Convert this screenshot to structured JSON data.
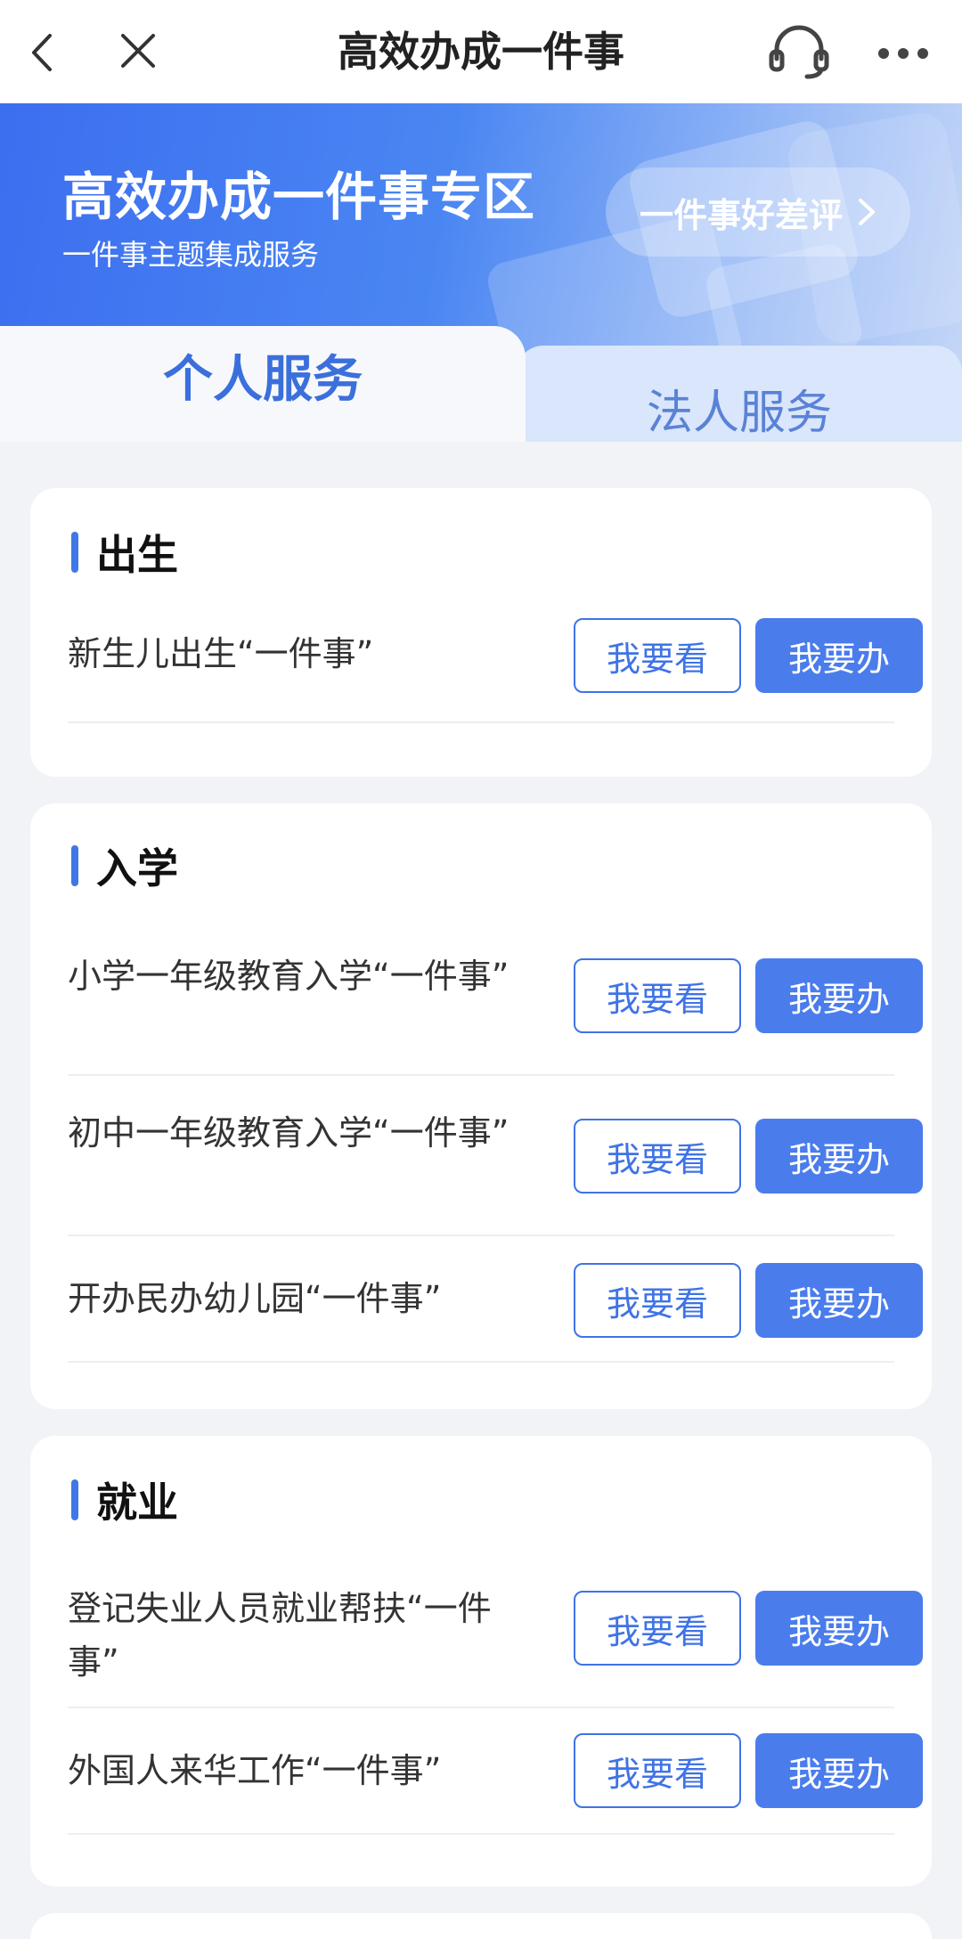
{
  "nav": {
    "title": "高效办成一件事"
  },
  "banner": {
    "title": "高效办成一件事专区",
    "subtitle": "一件事主题集成服务",
    "review_label": "一件事好差评"
  },
  "tabs": [
    {
      "label": "个人服务",
      "active": true
    },
    {
      "label": "法人服务",
      "active": false
    }
  ],
  "buttons": {
    "view": "我要看",
    "do": "我要办"
  },
  "sections": [
    {
      "title": "出生",
      "items": [
        {
          "name": "新生儿出生“一件事”"
        }
      ]
    },
    {
      "title": "入学",
      "items": [
        {
          "name": "小学一年级教育入学“一件事”"
        },
        {
          "name": "初中一年级教育入学“一件事”"
        },
        {
          "name": "开办民办幼儿园“一件事”"
        }
      ]
    },
    {
      "title": "就业",
      "items": [
        {
          "name": "登记失业人员就业帮扶“一件事”"
        },
        {
          "name": "外国人来华工作“一件事”"
        }
      ]
    }
  ],
  "colors": {
    "accent": "#4a7cec",
    "tab_active_text": "#3b6fdc",
    "banner_blue": "#3c6ef0"
  }
}
